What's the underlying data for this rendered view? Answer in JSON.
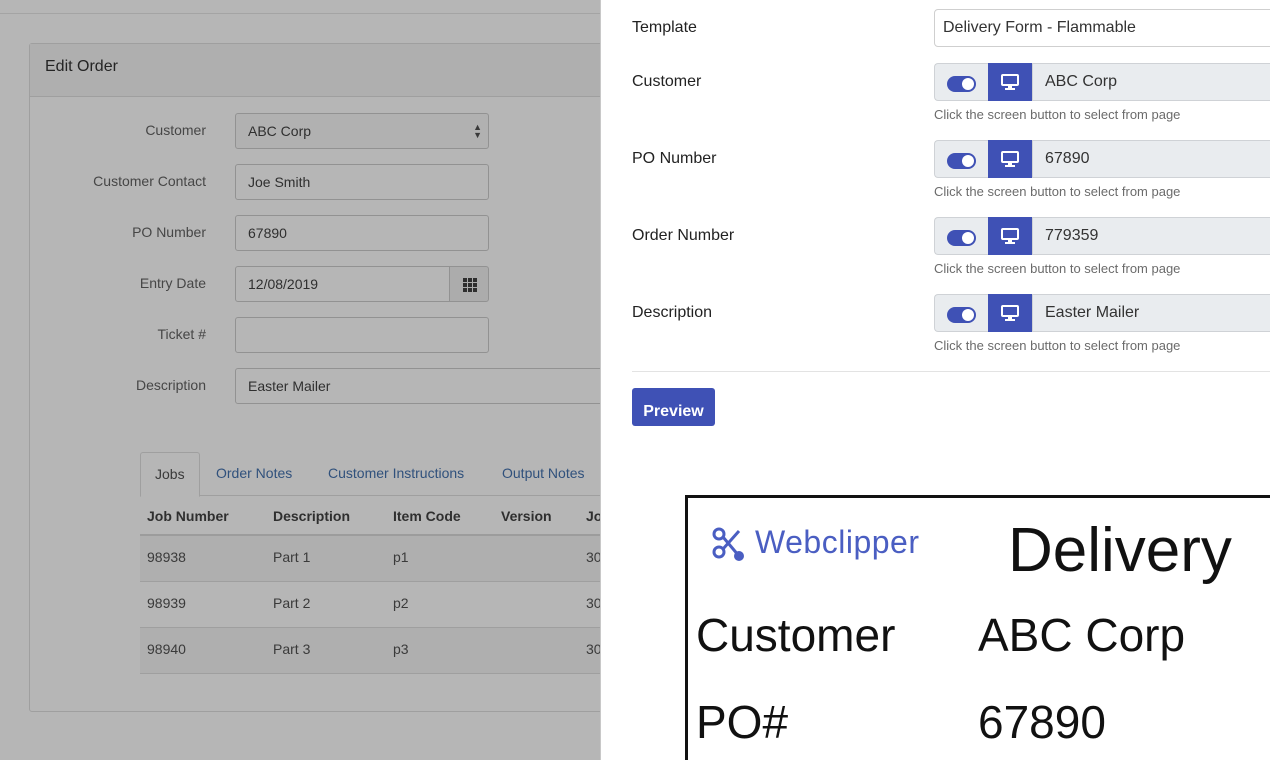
{
  "edit_order": {
    "title": "Edit Order",
    "fields": [
      {
        "label": "Customer",
        "value": "ABC Corp"
      },
      {
        "label": "Customer Contact",
        "value": "Joe Smith"
      },
      {
        "label": "PO Number",
        "value": "67890"
      },
      {
        "label": "Entry Date",
        "value": "12/08/2019"
      },
      {
        "label": "Ticket #",
        "value": ""
      },
      {
        "label": "Description",
        "value": "Easter Mailer"
      }
    ],
    "tabs": [
      "Jobs",
      "Order Notes",
      "Customer Instructions",
      "Output Notes"
    ],
    "jobs_table": {
      "headers": [
        "Job Number",
        "Description",
        "Item Code",
        "Version",
        "Jo"
      ],
      "rows": [
        [
          "98938",
          "Part 1",
          "p1",
          "",
          "30"
        ],
        [
          "98939",
          "Part 2",
          "p2",
          "",
          "30"
        ],
        [
          "98940",
          "Part 3",
          "p3",
          "",
          "30"
        ]
      ]
    }
  },
  "panel": {
    "template_label": "Template",
    "template_value": "Delivery Form - Flammable",
    "fields": [
      {
        "label": "Customer",
        "value": "ABC Corp",
        "hint": "Click the screen button to select from page",
        "enabled": true
      },
      {
        "label": "PO Number",
        "value": "67890",
        "hint": "Click the screen button to select from page",
        "enabled": true
      },
      {
        "label": "Order Number",
        "value": "779359",
        "hint": "Click the screen button to select from page",
        "enabled": true
      },
      {
        "label": "Description",
        "value": "Easter Mailer",
        "hint": "Click the screen button to select from page",
        "enabled": true
      }
    ],
    "preview_label": "Preview",
    "accent_color": "#3f51b5"
  },
  "preview_doc": {
    "brand": "Webclipper",
    "title": "Delivery",
    "rows": [
      {
        "label": "Customer",
        "value": "ABC Corp"
      },
      {
        "label": "PO#",
        "value": "67890"
      }
    ]
  },
  "icons": {
    "screen_button": "monitor-icon",
    "calendar_button": "calendar-grid-icon",
    "brand_logo": "scissors-icon"
  }
}
